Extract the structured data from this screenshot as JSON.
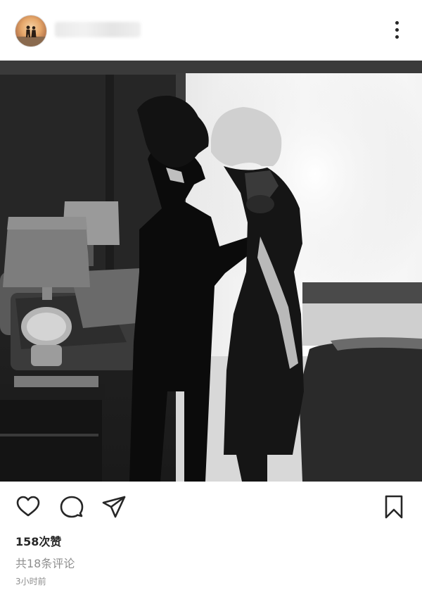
{
  "post": {
    "username": "",
    "more_icon": "more-vertical-icon",
    "likes_label": "158次赞",
    "comments_label": "共18条评论",
    "time_label": "3小时前"
  },
  "actions": {
    "like_icon": "heart-icon",
    "comment_icon": "comment-bubble-icon",
    "share_icon": "paper-plane-icon",
    "save_icon": "bookmark-icon"
  },
  "colors": {
    "text": "#262626",
    "muted": "#8e8e8e"
  }
}
